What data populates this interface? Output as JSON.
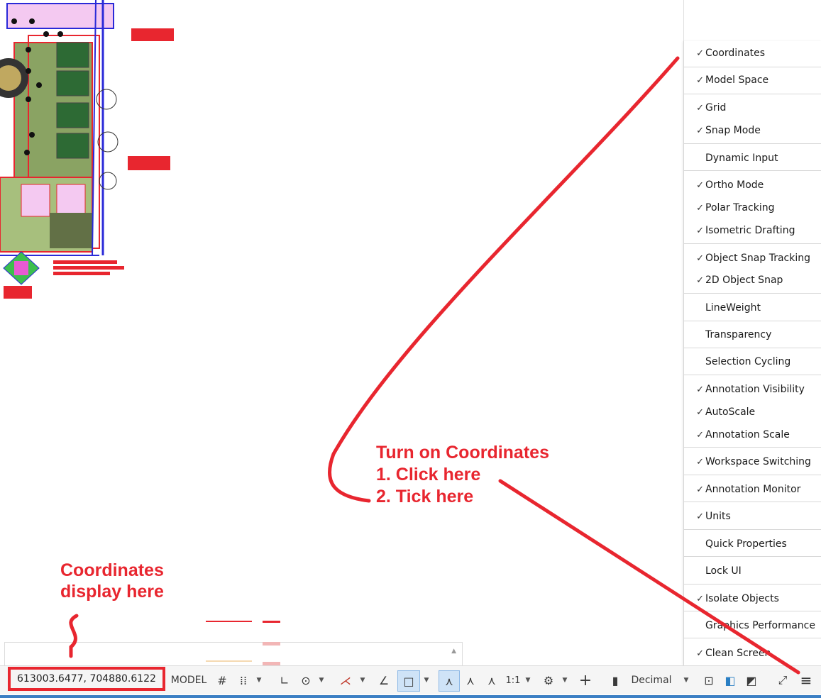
{
  "annotations": {
    "turn_on_line1": "Turn on Coordinates",
    "turn_on_line2": "1. Click here",
    "turn_on_line3": "2. Tick here",
    "display_line1": "Coordinates",
    "display_line2": "display here",
    "color": "#e8262f"
  },
  "menu": {
    "items": [
      {
        "label": "Coordinates",
        "checked": true
      },
      {
        "label": "Model Space",
        "checked": true
      },
      {
        "label": "Grid",
        "checked": true
      },
      {
        "label": "Snap Mode",
        "checked": true
      },
      {
        "label": "Dynamic Input",
        "checked": false
      },
      {
        "label": "Ortho Mode",
        "checked": true
      },
      {
        "label": "Polar Tracking",
        "checked": true
      },
      {
        "label": "Isometric Drafting",
        "checked": true
      },
      {
        "label": "Object Snap Tracking",
        "checked": true
      },
      {
        "label": "2D Object Snap",
        "checked": true
      },
      {
        "label": "LineWeight",
        "checked": false
      },
      {
        "label": "Transparency",
        "checked": false
      },
      {
        "label": "Selection Cycling",
        "checked": false
      },
      {
        "label": "Annotation Visibility",
        "checked": true
      },
      {
        "label": "AutoScale",
        "checked": true
      },
      {
        "label": "Annotation Scale",
        "checked": true
      },
      {
        "label": "Workspace Switching",
        "checked": true
      },
      {
        "label": "Annotation Monitor",
        "checked": true
      },
      {
        "label": "Units",
        "checked": true
      },
      {
        "label": "Quick Properties",
        "checked": false
      },
      {
        "label": "Lock UI",
        "checked": false
      },
      {
        "label": "Isolate Objects",
        "checked": true
      },
      {
        "label": "Graphics Performance",
        "checked": false
      },
      {
        "label": "Clean Screen",
        "checked": true
      }
    ],
    "check_glyph": "✓"
  },
  "statusbar": {
    "coordinates": "613003.6477, 704880.6122",
    "model_label": "MODEL",
    "scale_label": "1:1",
    "units_label": "Decimal",
    "icons": [
      "grid-icon",
      "snap-icon",
      "ortho-icon",
      "polar-icon",
      "isodraft-icon",
      "osnap-track-icon",
      "osnap-icon",
      "annot-visibility-icon",
      "autoscale-icon",
      "annotation-scale-icon",
      "workspace-gear-icon",
      "annotation-monitor-icon",
      "units-icon",
      "quick-properties-icon",
      "isolate-objects-icon",
      "graphics-performance-icon",
      "fullscreen-icon",
      "customization-menu-icon"
    ]
  },
  "colors": {
    "accent_blue": "#3b7fc4",
    "active_button_bg": "#cfe3f7"
  }
}
